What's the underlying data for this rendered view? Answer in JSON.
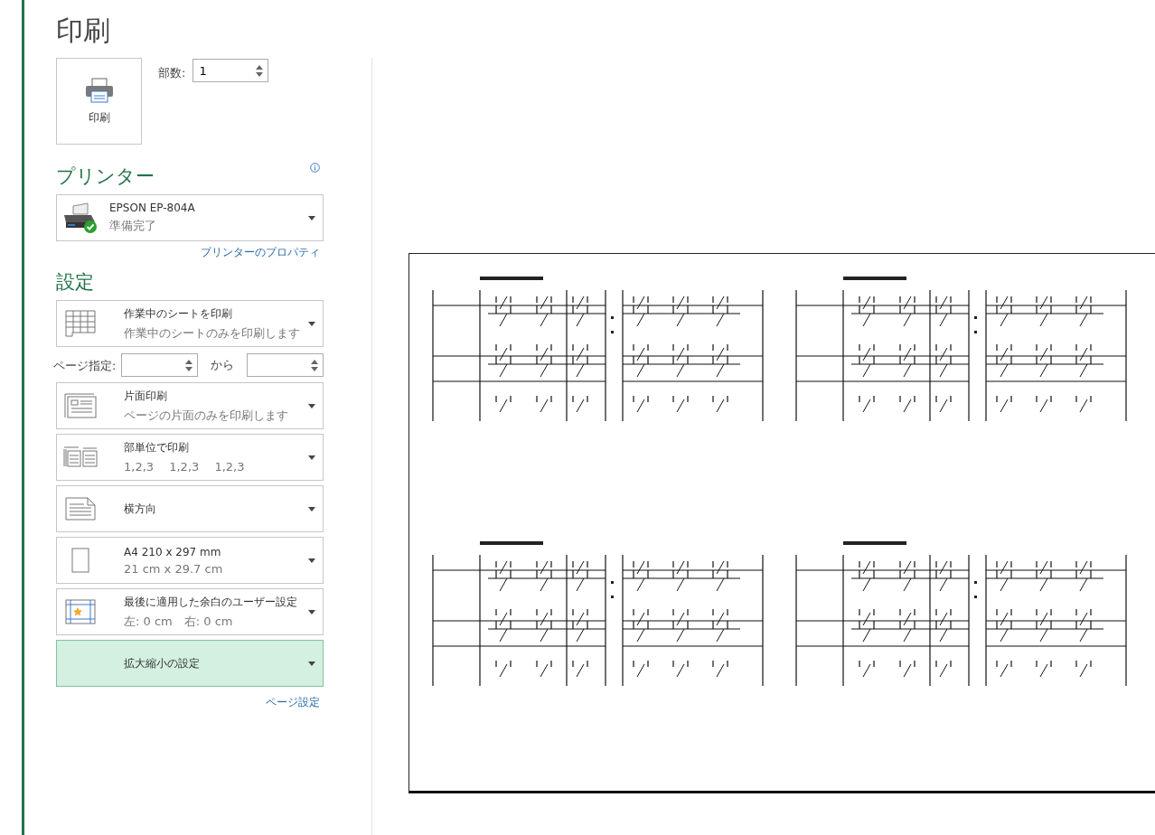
{
  "title": "印刷",
  "print_button": {
    "label": "印刷"
  },
  "copies": {
    "label": "部数:",
    "value": "1"
  },
  "printer": {
    "heading": "プリンター",
    "name": "EPSON EP-804A",
    "status": "準備完了",
    "properties_link": "プリンターのプロパティ"
  },
  "settings": {
    "heading": "設定",
    "items": [
      {
        "kind": "dropdown",
        "title": "作業中のシートを印刷",
        "subtitle": "作業中のシートのみを印刷します",
        "highlighted": false
      },
      {
        "kind": "range",
        "label": "ページ指定:",
        "separator": "から"
      },
      {
        "kind": "dropdown",
        "title": "片面印刷",
        "subtitle": "ページの片面のみを印刷します",
        "highlighted": false
      },
      {
        "kind": "dropdown",
        "title": "部単位で印刷",
        "subtitle": "1,2,3　 1,2,3　 1,2,3",
        "highlighted": false
      },
      {
        "kind": "dropdown",
        "title": "横方向",
        "highlighted": false
      },
      {
        "kind": "dropdown",
        "title": "A4 210 x 297 mm",
        "subtitle": "21 cm x 29.7 cm",
        "highlighted": false
      },
      {
        "kind": "dropdown",
        "title": "最後に適用した余白のユーザー設定",
        "subtitle": "左:  0 cm　右:  0 cm",
        "highlighted": false
      },
      {
        "kind": "dropdown",
        "title": "拡大縮小の設定",
        "highlighted": true
      }
    ],
    "page_setup_link": "ページ設定"
  },
  "preview": {
    "kind": "document"
  }
}
